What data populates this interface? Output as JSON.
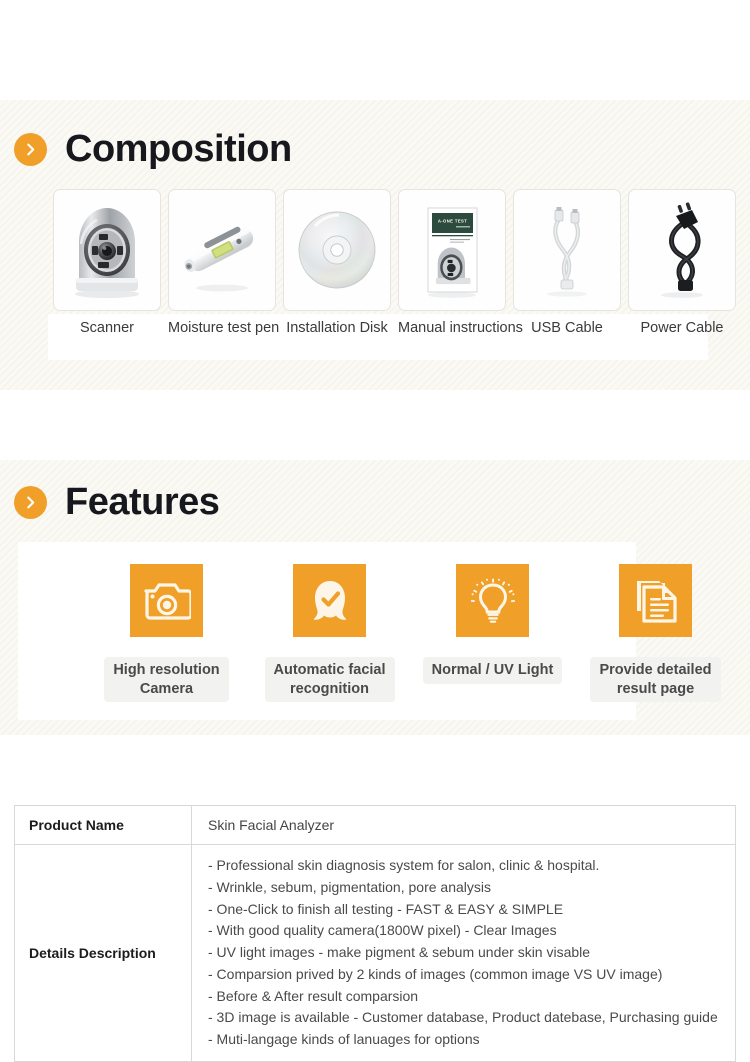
{
  "composition": {
    "heading": "Composition",
    "badge_icon": "chevron-right-icon",
    "items": [
      {
        "label": "Scanner",
        "icon": "scanner-device-image"
      },
      {
        "label": "Moisture test pen",
        "icon": "moisture-pen-image"
      },
      {
        "label": "Installation Disk",
        "icon": "cd-disk-image"
      },
      {
        "label": "Manual instructions",
        "icon": "manual-booklet-image",
        "cover_title": "A-ONE TEST"
      },
      {
        "label": "USB Cable",
        "icon": "usb-cable-image"
      },
      {
        "label": "Power Cable",
        "icon": "power-cable-image"
      }
    ]
  },
  "features": {
    "heading": "Features",
    "badge_icon": "chevron-right-icon",
    "items": [
      {
        "label": "High resolution\nCamera",
        "line1": "High resolution",
        "line2": "Camera",
        "icon": "camera-icon"
      },
      {
        "label": "Automatic facial\nrecognition",
        "line1": "Automatic facial",
        "line2": "recognition",
        "icon": "face-recognition-icon"
      },
      {
        "label": "Normal / UV Light",
        "line1": "Normal / UV Light",
        "line2": "",
        "icon": "lightbulb-icon"
      },
      {
        "label": "Provide detailed\nresult page",
        "line1": "Provide detailed",
        "line2": "result page",
        "icon": "documents-icon"
      }
    ]
  },
  "spec_table": {
    "rows": [
      {
        "key": "Product Name",
        "value": "Skin Facial Analyzer"
      },
      {
        "key": "Details Description",
        "lines": [
          "- Professional skin diagnosis system for salon, clinic & hospital.",
          "- Wrinkle, sebum, pigmentation, pore analysis",
          "- One-Click to finish all testing - FAST & EASY & SIMPLE",
          "- With good quality camera(1800W pixel) - Clear Images",
          "- UV light images - make pigment & sebum under skin visable",
          "- Comparsion prived by 2 kinds of images (common image VS UV image)",
          "- Before & After result comparsion",
          "- 3D image is available - Customer database, Product datebase, Purchasing guide",
          "- Muti-langage kinds of lanuages for options"
        ]
      }
    ]
  },
  "colors": {
    "accent_orange": "#f0a029",
    "band_bg": "#faf9f4",
    "heading_text": "#16181d",
    "manual_cover_green": "#2d4a3e"
  }
}
